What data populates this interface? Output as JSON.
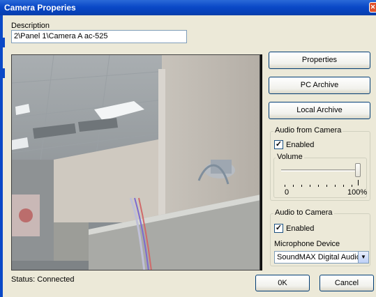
{
  "window": {
    "title": "Camera Properies",
    "close_glyph": "✕"
  },
  "description": {
    "label": "Description",
    "value": "2\\Panel 1\\Camera A ac-525"
  },
  "video": {
    "icon": "camera-feed"
  },
  "buttons": {
    "properties": "Properties",
    "pc_archive": "PC Archive",
    "local_archive": "Local Archive",
    "ok": "0K",
    "cancel": "Cancel"
  },
  "audio_from_camera": {
    "title": "Audio from Camera",
    "enabled_label": "Enabled",
    "enabled": true,
    "volume_label": "Volume",
    "volume_min": "0",
    "volume_max": "100%",
    "volume_level": 1.0
  },
  "audio_to_camera": {
    "title": "Audio to Camera",
    "enabled_label": "Enabled",
    "enabled": true,
    "mic_label": "Microphone Device",
    "mic_value": "SoundMAX Digital Audio"
  },
  "status": {
    "text": "Status: Connected"
  },
  "colors": {
    "titlebar": "#0a49c7",
    "dialog": "#ece9d8",
    "accent_border": "#003c74"
  }
}
